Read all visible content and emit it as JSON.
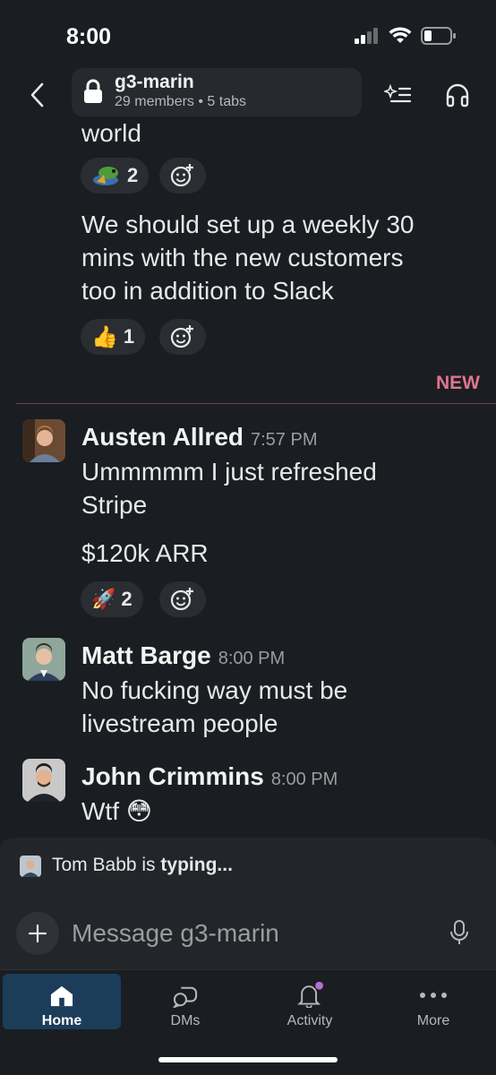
{
  "status_bar": {
    "time": "8:00"
  },
  "header": {
    "channel_name": "g3-marin",
    "members": "29 members",
    "tabs": "5 tabs"
  },
  "messages": {
    "partial_text": "world",
    "reaction_1": {
      "emoji": "party-parrot",
      "count": "2"
    },
    "msg_weekly": "We should set up a weekly 30\nmins with the new customers\ntoo in addition to Slack",
    "reaction_2": {
      "emoji": "👍",
      "count": "1"
    },
    "new_label": "NEW",
    "austen": {
      "author": "Austen Allred",
      "time": "7:57 PM",
      "text_1": "Ummmmm I just refreshed\nStripe",
      "text_2": "$120k ARR",
      "reaction": {
        "emoji": "🚀",
        "count": "2"
      }
    },
    "matt": {
      "author": "Matt Barge",
      "time": "8:00 PM",
      "text": "No fucking way must be\nlivestream people"
    },
    "john": {
      "author": "John Crimmins",
      "time": "8:00 PM",
      "text": "Wtf 😳"
    }
  },
  "typing": {
    "name": "Tom Babb is",
    "status": "typing..."
  },
  "composer": {
    "placeholder": "Message g3-marin"
  },
  "tabbar": {
    "home": "Home",
    "dms": "DMs",
    "activity": "Activity",
    "more": "More"
  },
  "colors": {
    "background": "#1a1d21",
    "new_accent": "#e0748f",
    "active_tab": "#1c3d5a",
    "activity_badge": "#b46fd6"
  }
}
